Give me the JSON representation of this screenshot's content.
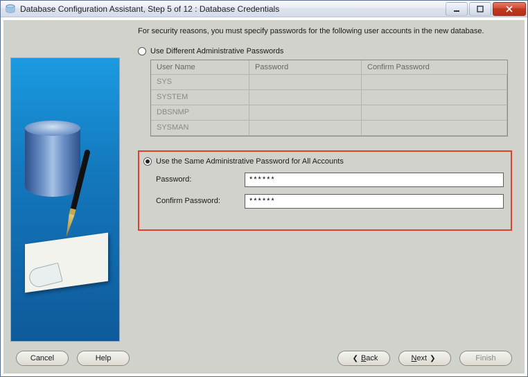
{
  "window": {
    "title": "Database Configuration Assistant, Step 5 of 12 : Database Credentials"
  },
  "instruction": "For security reasons, you must specify passwords for the following user accounts in the new database.",
  "options": {
    "different": {
      "label": "Use Different Administrative Passwords",
      "selected": false
    },
    "same": {
      "label": "Use the Same Administrative Password for All Accounts",
      "selected": true
    }
  },
  "table": {
    "headers": {
      "user": "User Name",
      "password": "Password",
      "confirm": "Confirm Password"
    },
    "rows": [
      "SYS",
      "SYSTEM",
      "DBSNMP",
      "SYSMAN"
    ]
  },
  "fields": {
    "password": {
      "label": "Password:",
      "value": "******"
    },
    "confirm": {
      "label": "Confirm Password:",
      "value": "******"
    }
  },
  "buttons": {
    "cancel": "Cancel",
    "help": "Help",
    "back": "Back",
    "next": "Next",
    "finish": "Finish"
  }
}
